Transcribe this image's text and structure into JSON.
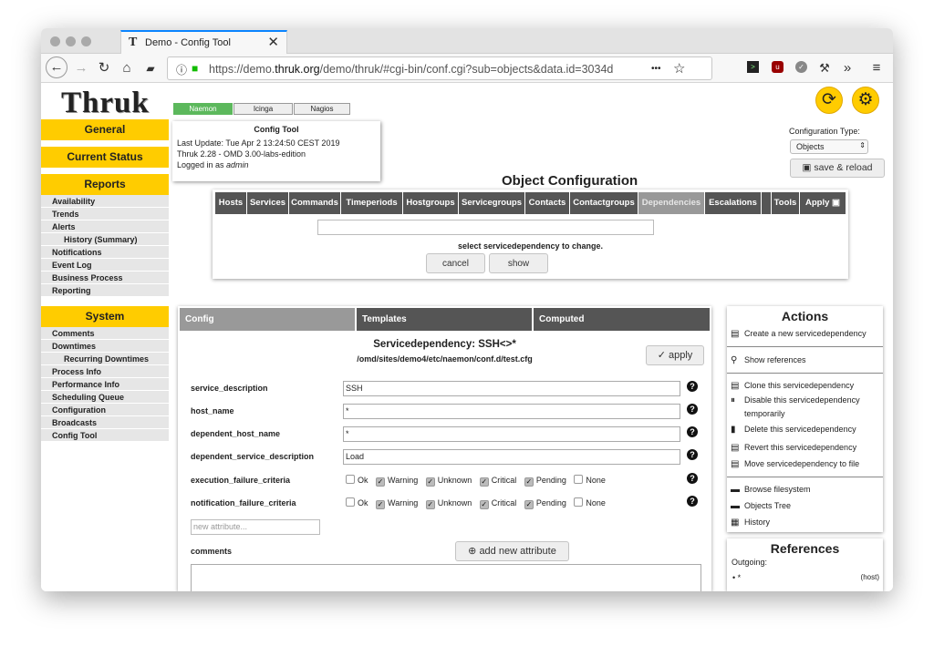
{
  "browser": {
    "tab_title": "Demo - Config Tool",
    "tab_close": "✕",
    "url_prefix": "https://demo.",
    "url_host": "thruk.org",
    "url_rest": "/demo/thruk/#cgi-bin/conf.cgi?sub=objects&data.id=3034d",
    "menu_dots": "•••"
  },
  "header": {
    "logo": "Thruk",
    "backends": [
      "Naemon",
      "Icinga",
      "Nagios"
    ],
    "active_backend_color": "#5cb85c"
  },
  "sidebar": {
    "general": "General",
    "current_status": "Current Status",
    "reports": "Reports",
    "report_items": [
      "Availability",
      "Trends",
      "Alerts",
      "History (Summary)",
      "Notifications",
      "Event Log",
      "Business Process",
      "Reporting"
    ],
    "system": "System",
    "system_items": [
      "Comments",
      "Downtimes",
      "Recurring Downtimes",
      "Process Info",
      "Performance Info",
      "Scheduling Queue",
      "Configuration",
      "Broadcasts",
      "Config Tool"
    ]
  },
  "info_box": {
    "title": "Config Tool",
    "last_update": "Last Update: Tue Apr 2 13:24:50 CEST 2019",
    "version": "Thruk 2.28 - OMD 3.00-labs-edition",
    "logged_in_prefix": "Logged in as ",
    "user": "admin"
  },
  "config_type": {
    "label": "Configuration Type:",
    "value": "Objects",
    "save_label": "save & reload"
  },
  "object_config": {
    "title": "Object Configuration",
    "tabs": [
      "Hosts",
      "Services",
      "Commands",
      "Timeperiods",
      "Hostgroups",
      "Servicegroups",
      "Contacts",
      "Contactgroups",
      "Dependencies",
      "Escalations",
      "",
      "Tools",
      "Apply"
    ],
    "active_tab": "Dependencies",
    "hint": "select servicedependency to change.",
    "cancel": "cancel",
    "show": "show"
  },
  "editor": {
    "tabs": [
      "Config",
      "Templates",
      "Computed"
    ],
    "title": "Servicedependency: SSH<>*",
    "path": "/omd/sites/demo4/etc/naemon/conf.d/test.cfg",
    "apply": "apply",
    "fields": [
      {
        "label": "service_description",
        "value": "SSH"
      },
      {
        "label": "host_name",
        "value": "*"
      },
      {
        "label": "dependent_host_name",
        "value": "*"
      },
      {
        "label": "dependent_service_description",
        "value": "Load"
      }
    ],
    "criteria": [
      {
        "label": "execution_failure_criteria"
      },
      {
        "label": "notification_failure_criteria"
      }
    ],
    "criteria_options": [
      {
        "name": "Ok",
        "checked": false
      },
      {
        "name": "Warning",
        "checked": true
      },
      {
        "name": "Unknown",
        "checked": true
      },
      {
        "name": "Critical",
        "checked": true
      },
      {
        "name": "Pending",
        "checked": true
      },
      {
        "name": "None",
        "checked": false
      }
    ],
    "new_attr_placeholder": "new attribute...",
    "comments_label": "comments",
    "add_attr": "add new attribute",
    "help": "?"
  },
  "actions": {
    "title": "Actions",
    "create": "Create a new servicedependency",
    "show_refs": "Show references",
    "clone": "Clone this servicedependency",
    "disable_1": "Disable this servicedependency",
    "disable_2": "temporarily",
    "delete": "Delete this servicedependency",
    "revert": "Revert this servicedependency",
    "move": "Move servicedependency to file",
    "browse": "Browse filesystem",
    "tree": "Objects Tree",
    "history": "History"
  },
  "references": {
    "title": "References",
    "outgoing": "Outgoing:",
    "item": "*",
    "type": "(host)"
  }
}
